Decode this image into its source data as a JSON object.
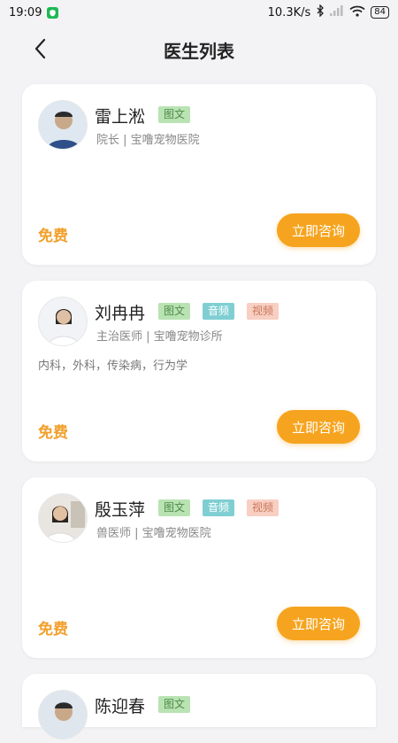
{
  "status_bar": {
    "time": "19:09",
    "network_speed": "10.3K/s",
    "battery": "84",
    "icons": [
      "shield-icon",
      "bluetooth-icon",
      "signal-icon",
      "wifi-icon",
      "battery-icon"
    ]
  },
  "header": {
    "title": "医生列表",
    "back_icon": "chevron-left-icon"
  },
  "doctors": [
    {
      "name": "雷上淞",
      "tags": [
        "图文"
      ],
      "meta": "院长 | 宝噜宠物医院",
      "specialties": "",
      "price": "免费",
      "cta": "立即咨询"
    },
    {
      "name": "刘冉冉",
      "tags": [
        "图文",
        "音频",
        "视频"
      ],
      "meta": "主治医师 | 宝噜宠物诊所",
      "specialties": "内科，外科，传染病，行为学",
      "price": "免费",
      "cta": "立即咨询"
    },
    {
      "name": "殷玉萍",
      "tags": [
        "图文",
        "音频",
        "视频"
      ],
      "meta": "兽医师 | 宝噜宠物医院",
      "specialties": "",
      "price": "免费",
      "cta": "立即咨询"
    },
    {
      "name": "陈迎春",
      "tags": [
        "图文"
      ]
    }
  ],
  "colors": {
    "accent": "#f6a41f",
    "price": "#f2a02c",
    "tag_text_bg": "#b9e3b3",
    "tag_audio_bg": "#7fcfd2",
    "tag_video_bg": "#f8cfc2",
    "background": "#f3f3f5"
  }
}
